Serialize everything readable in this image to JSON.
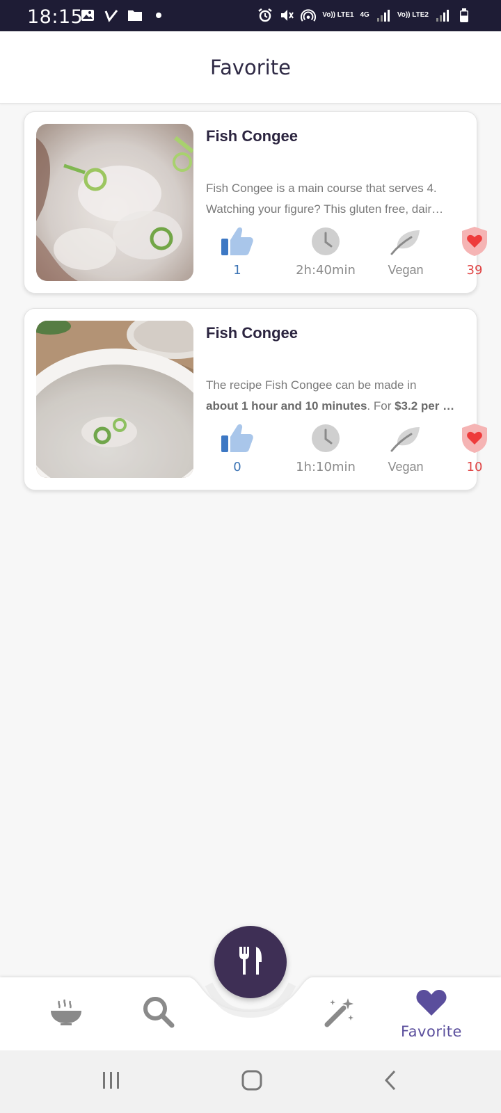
{
  "status_bar": {
    "time": "18:15",
    "network_1": "Vo)) LTE1",
    "network_type": "4G",
    "network_2": "Vo)) LTE2"
  },
  "header": {
    "title": "Favorite"
  },
  "recipes": [
    {
      "name": "Fish Congee",
      "desc_line1": "Fish Congee is a main course that serves 4.",
      "desc_line2": "Watching your figure? This gluten free, dair…",
      "likes": "1",
      "time": "2h:40min",
      "diet": "Vegan",
      "favorites": "39"
    },
    {
      "name": "Fish Congee",
      "desc_line1": "The recipe Fish Congee can be made in",
      "desc_line2_bold": "about 1 hour and 10 minutes",
      "desc_line2_rest": ". For ",
      "desc_line2_price": "$3.2 per …",
      "likes": "0",
      "time": "1h:10min",
      "diet": "Vegan",
      "favorites": "10"
    }
  ],
  "bottom_nav": {
    "items": [
      "recipes-bowl-icon",
      "search-icon",
      "magic-wand-icon",
      "heart-icon"
    ],
    "active_label": "Favorite",
    "active_color": "#5a4e9c",
    "fab_icon": "fork-knife-icon"
  }
}
